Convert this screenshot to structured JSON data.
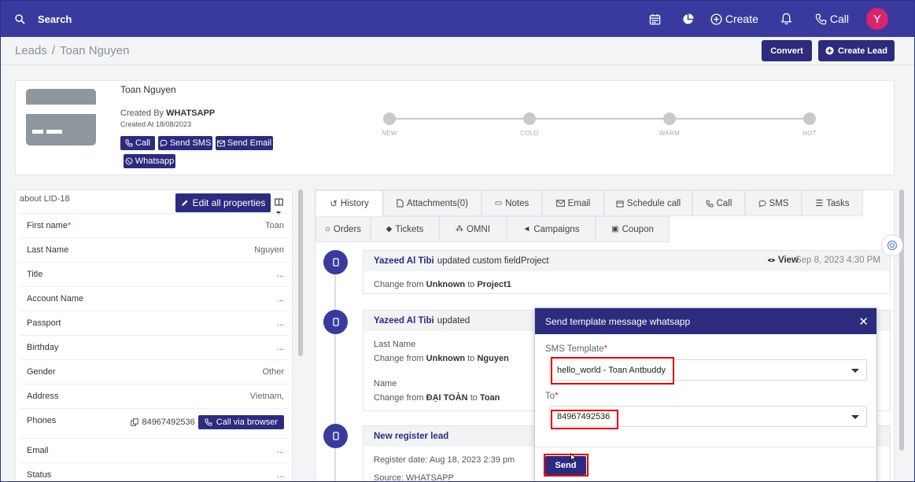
{
  "topbar": {
    "search_label": "Search",
    "create_label": "Create",
    "call_label": "Call",
    "avatar_letter": "Y",
    "avatar_color": "#d9246f",
    "bar_color": "#3a3a9e"
  },
  "breadcrumb": {
    "root": "Leads",
    "separator": "/",
    "current": "Toan Nguyen"
  },
  "header_actions": {
    "convert": "Convert",
    "create_lead": "Create Lead"
  },
  "lead": {
    "name": "Toan Nguyen",
    "created_by_prefix": "Created By",
    "created_by": "WHATSAPP",
    "created_at": "Created At 18/08/2023",
    "actions": {
      "call": "Call",
      "send_sms": "Send SMS",
      "send_email": "Send Email",
      "whatsapp": "Whatsapp"
    },
    "stages": [
      "NEW",
      "COLD",
      "WARM",
      "HOT"
    ]
  },
  "properties": {
    "title": "about LID-18",
    "edit_all": "Edit all properties",
    "rows": [
      {
        "key": "First name",
        "value": "Toan"
      },
      {
        "key": "Last Name",
        "value": "Nguyen"
      },
      {
        "key": "Title",
        "value": "..."
      },
      {
        "key": "Account Name",
        "value": "..."
      },
      {
        "key": "Passport",
        "value": "..."
      },
      {
        "key": "Birthday",
        "value": "..."
      },
      {
        "key": "Gender",
        "value": "Other"
      },
      {
        "key": "Address",
        "value": "Vietnam,"
      },
      {
        "key": "Phones",
        "value": "84967492536"
      },
      {
        "key": "Email",
        "value": "..."
      },
      {
        "key": "Status",
        "value": "..."
      }
    ],
    "call_via_browser": "Call via browser"
  },
  "tabs": {
    "row1": [
      "History",
      "Attachments(0)",
      "Notes",
      "Email",
      "Schedule call",
      "Call",
      "SMS",
      "Tasks"
    ],
    "row2": [
      "Orders",
      "Tickets",
      "OMNI",
      "Campaigns",
      "Coupon"
    ]
  },
  "timeline": [
    {
      "who": "Yazeed Al Tibi",
      "action": "updated custom fieldProject",
      "view": "View",
      "date": "Sep 8, 2023 4:30 PM",
      "change_prefix": "Change from",
      "from": "Unknown",
      "to_word": "to",
      "to": "Project1"
    },
    {
      "who": "Yazeed Al Tibi",
      "action": "updated",
      "field1": "Last Name",
      "change_prefix": "Change from",
      "from1": "Unknown",
      "to_word": "to",
      "to1": "Nguyen",
      "field2": "Name",
      "from2": "ĐẠI TOÀN",
      "to2": "Toan"
    },
    {
      "title": "New register lead",
      "register_date": "Register date: Aug 18, 2023 2:39 pm",
      "source_prefix": "Source:",
      "source": "WHATSAPP"
    }
  ],
  "modal": {
    "title": "Send template message whatsapp",
    "template_label": "SMS Template",
    "template_value": "hello_world - Toan Antbuddy",
    "to_label": "To",
    "to_value": "84967492536",
    "send": "Send",
    "required_mark": "*"
  }
}
